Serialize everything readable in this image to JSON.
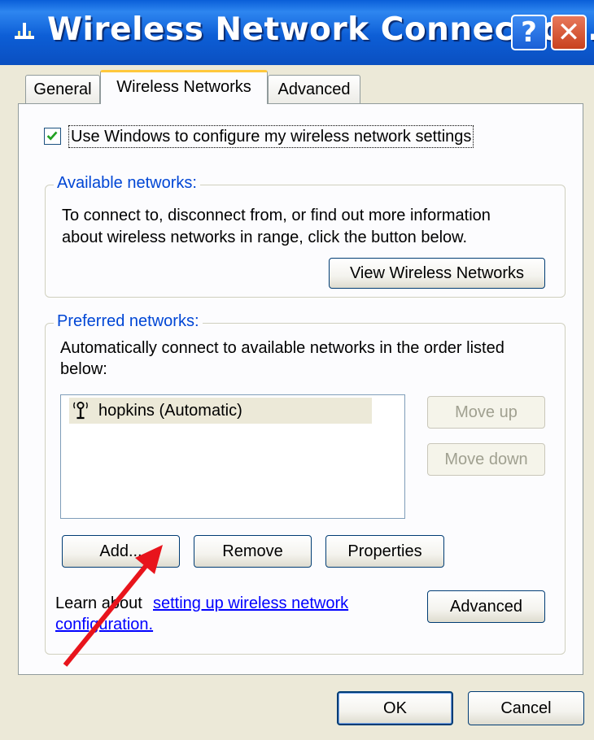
{
  "window": {
    "title": "Wireless Network Connectio..."
  },
  "titlebar_buttons": {
    "help": "?",
    "close": "✕"
  },
  "tabs": [
    {
      "label": "General"
    },
    {
      "label": "Wireless Networks"
    },
    {
      "label": "Advanced"
    }
  ],
  "checkbox": {
    "label": "Use Windows to configure my wireless network settings",
    "checked": true
  },
  "available": {
    "legend": "Available networks:",
    "description_line1": "To connect to, disconnect from, or find out more information",
    "description_line2": "about wireless networks in range, click the button below.",
    "view_button": "View Wireless Networks"
  },
  "preferred": {
    "legend": "Preferred networks:",
    "description_line1": "Automatically connect to available networks in the order listed",
    "description_line2": "below:",
    "networks": [
      {
        "name": "hopkins (Automatic)",
        "icon": "wireless-antenna-icon"
      }
    ],
    "move_up": "Move up",
    "move_down": "Move down",
    "add": "Add...",
    "remove": "Remove",
    "properties": "Properties"
  },
  "learn": {
    "prefix": "Learn about ",
    "link_line1": "setting up wireless network",
    "link_line2": "configuration.",
    "advanced_button": "Advanced"
  },
  "footer": {
    "ok": "OK",
    "cancel": "Cancel"
  },
  "colors": {
    "accent_arrow": "#e8141c",
    "titlebar": "#0a5fd8",
    "link": "#0000ff"
  }
}
